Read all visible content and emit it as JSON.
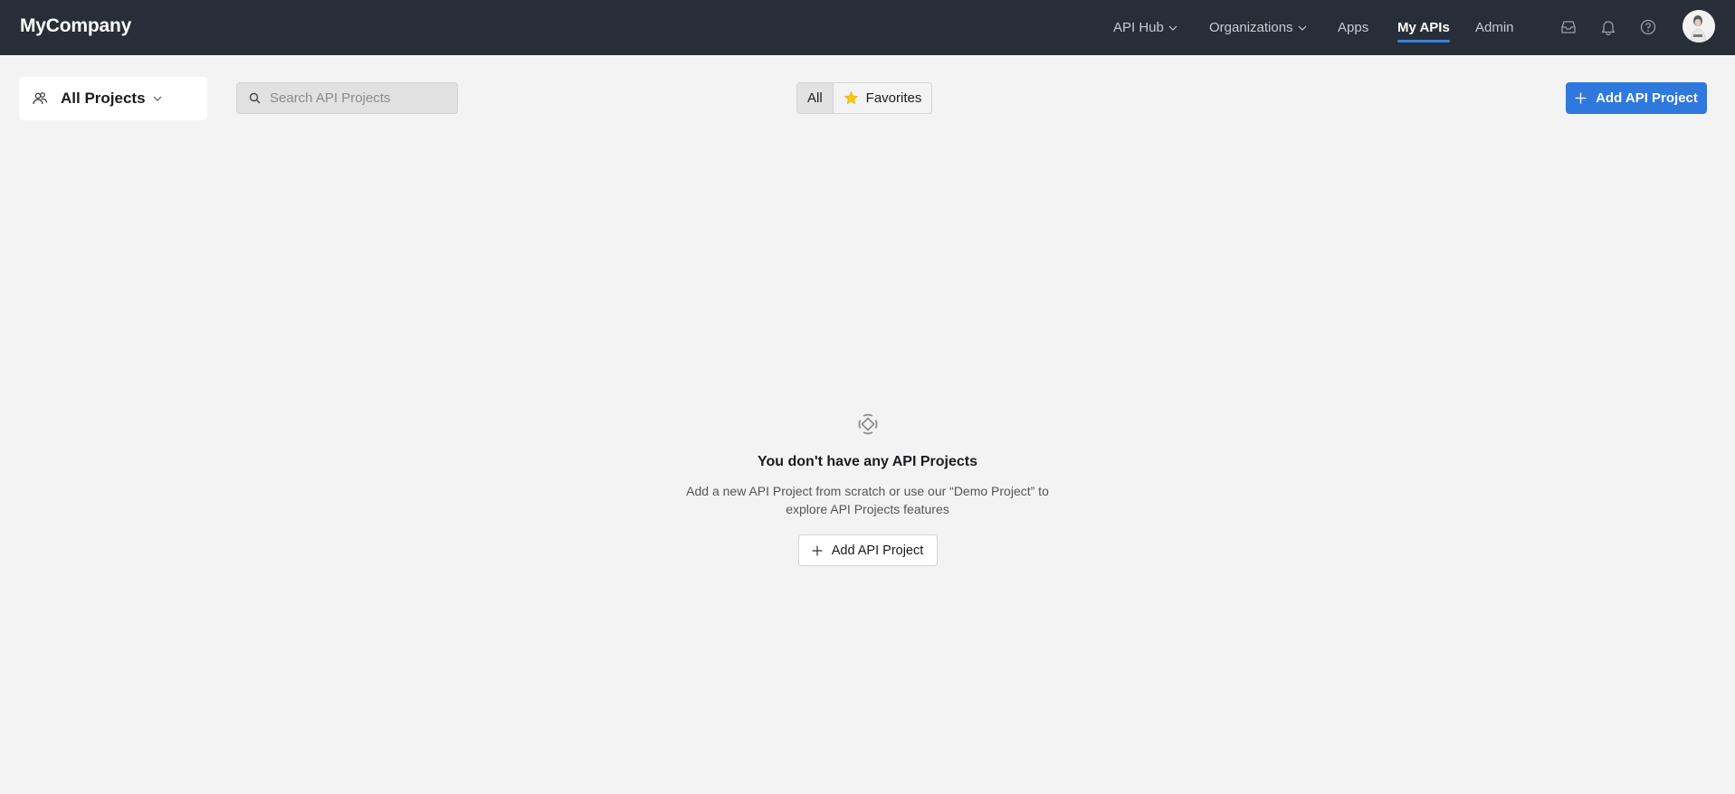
{
  "header": {
    "brand": "MyCompany",
    "nav": [
      {
        "label": "API Hub",
        "dropdown": true,
        "active": false
      },
      {
        "label": "Organizations",
        "dropdown": true,
        "active": false
      },
      {
        "label": "Apps",
        "dropdown": false,
        "active": false
      },
      {
        "label": "My APIs",
        "dropdown": false,
        "active": true
      },
      {
        "label": "Admin",
        "dropdown": false,
        "active": false
      }
    ],
    "icons": [
      "inbox-icon",
      "bell-icon",
      "help-icon"
    ],
    "accent_color": "#3b7fd9"
  },
  "toolbar": {
    "project_filter": "All Projects",
    "search_placeholder": "Search API Projects",
    "search_value": "",
    "segments": [
      {
        "label": "All",
        "selected": true
      },
      {
        "label": "Favorites",
        "selected": false
      }
    ],
    "add_button": "Add API Project",
    "primary_color": "#2f78dd"
  },
  "empty_state": {
    "title": "You don't have any API Projects",
    "description": "Add a new API Project from scratch or use our “Demo Project” to explore API Projects features",
    "button": "Add API Project"
  }
}
